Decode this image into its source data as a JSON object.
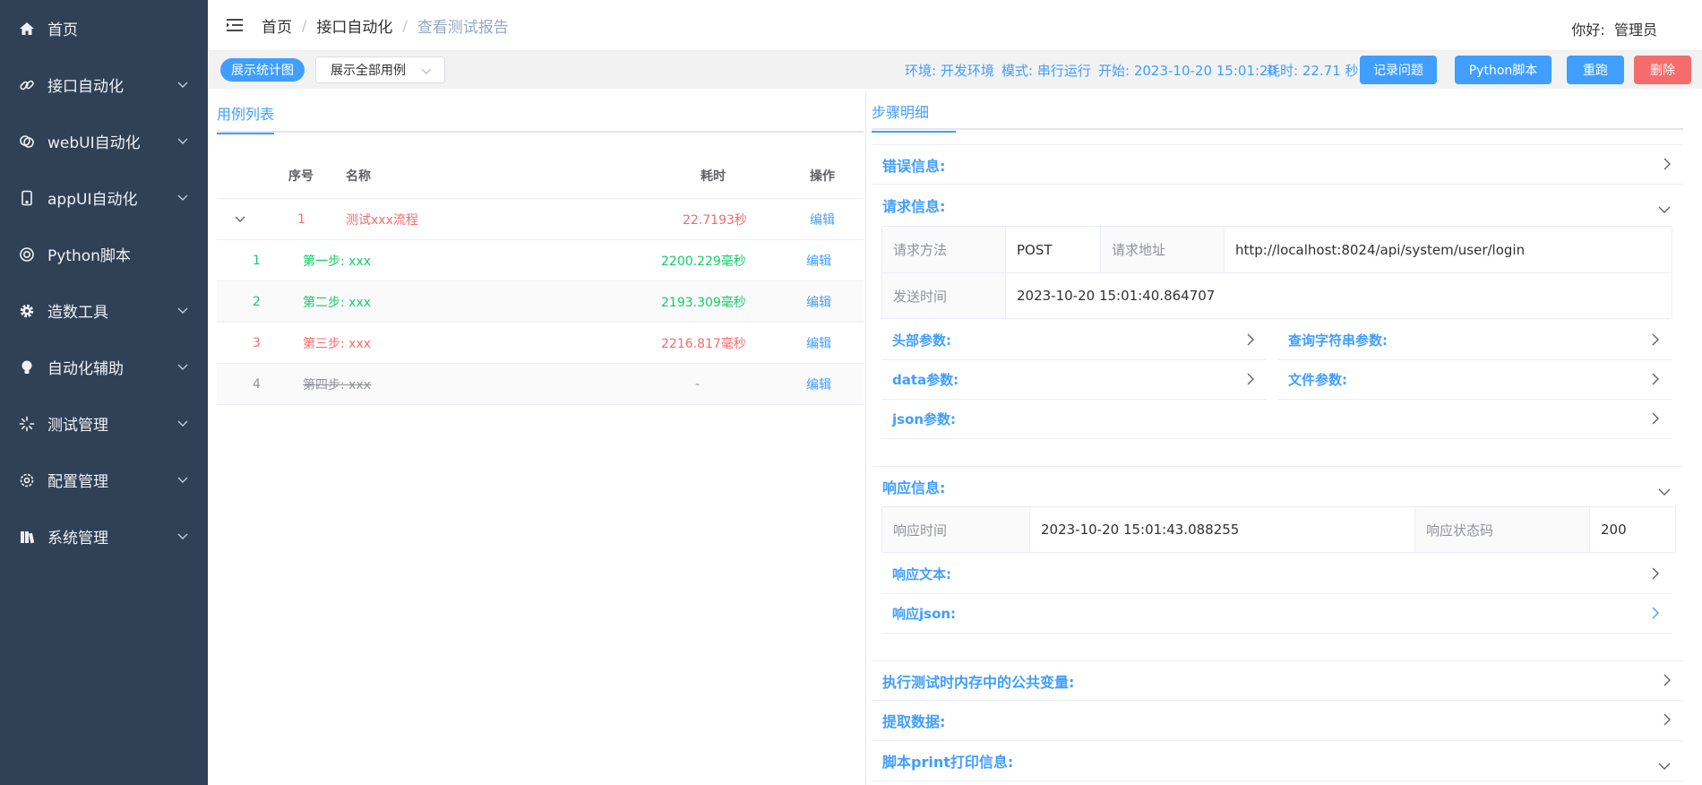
{
  "sidebar": {
    "items": [
      {
        "label": "首页",
        "icon": "home-icon",
        "has_children": false
      },
      {
        "label": "接口自动化",
        "icon": "link-icon",
        "has_children": true
      },
      {
        "label": "webUI自动化",
        "icon": "chat-rings-icon",
        "has_children": true
      },
      {
        "label": "appUI自动化",
        "icon": "mobile-icon",
        "has_children": true
      },
      {
        "label": "Python脚本",
        "icon": "lifebuoy-icon",
        "has_children": false
      },
      {
        "label": "造数工具",
        "icon": "gear-icon",
        "has_children": true
      },
      {
        "label": "自动化辅助",
        "icon": "bulb-icon",
        "has_children": true
      },
      {
        "label": "测试管理",
        "icon": "loading-icon",
        "has_children": true
      },
      {
        "label": "配置管理",
        "icon": "settings-icon",
        "has_children": true
      },
      {
        "label": "系统管理",
        "icon": "library-icon",
        "has_children": true
      }
    ]
  },
  "header": {
    "breadcrumb": [
      "首页",
      "接口自动化",
      "查看测试报告"
    ],
    "greeting": "你好:  管理员"
  },
  "toolbar": {
    "stats_toggle": "展示统计图",
    "case_filter": "展示全部用例",
    "env": "环境: 开发环境",
    "mode": "模式: 串行运行",
    "start": "开始: 2023-10-20 15:01:20",
    "duration": "耗时: 22.71 秒",
    "btn_record": "记录问题",
    "btn_python": "Python脚本",
    "btn_rerun": "重跑",
    "btn_delete": "删除"
  },
  "left": {
    "tab": "用例列表",
    "columns": {
      "index": "序号",
      "name": "名称",
      "time": "耗时",
      "action": "操作"
    },
    "case": {
      "index": "1",
      "name": "测试xxx流程",
      "time": "22.7193秒",
      "action": "编辑"
    },
    "steps": [
      {
        "index": "1",
        "name": "第一步: xxx",
        "time": "2200.229毫秒",
        "action": "编辑",
        "status": "success"
      },
      {
        "index": "2",
        "name": "第二步: xxx",
        "time": "2193.309毫秒",
        "action": "编辑",
        "status": "success"
      },
      {
        "index": "3",
        "name": "第三步: xxx",
        "time": "2216.817毫秒",
        "action": "编辑",
        "status": "fail"
      },
      {
        "index": "4",
        "name": "第四步: xxx",
        "time": "-",
        "action": "编辑",
        "status": "skipped"
      }
    ]
  },
  "right": {
    "tab": "步骤明细",
    "error_title": "错误信息:",
    "request_title": "请求信息:",
    "request": {
      "method_label": "请求方法",
      "method": "POST",
      "url_label": "请求地址",
      "url": "http://localhost:8024/api/system/user/login",
      "sent_label": "发送时间",
      "sent": "2023-10-20 15:01:40.864707"
    },
    "headers_title": "头部参数:",
    "query_title": "查询字符串参数:",
    "data_title": "data参数:",
    "file_title": "文件参数:",
    "json_title": "json参数:",
    "response_title": "响应信息:",
    "response": {
      "time_label": "响应时间",
      "time": "2023-10-20 15:01:43.088255",
      "status_label": "响应状态码",
      "status": "200"
    },
    "resp_text_title": "响应文本:",
    "resp_json_title": "响应json:",
    "vars_title": "执行测试时内存中的公共变量:",
    "extract_title": "提取数据:",
    "print_title": "脚本print打印信息:"
  },
  "colors": {
    "sidebar_bg": "#304156",
    "primary": "#409eff",
    "danger": "#f56c6c",
    "success": "#13ce66"
  }
}
